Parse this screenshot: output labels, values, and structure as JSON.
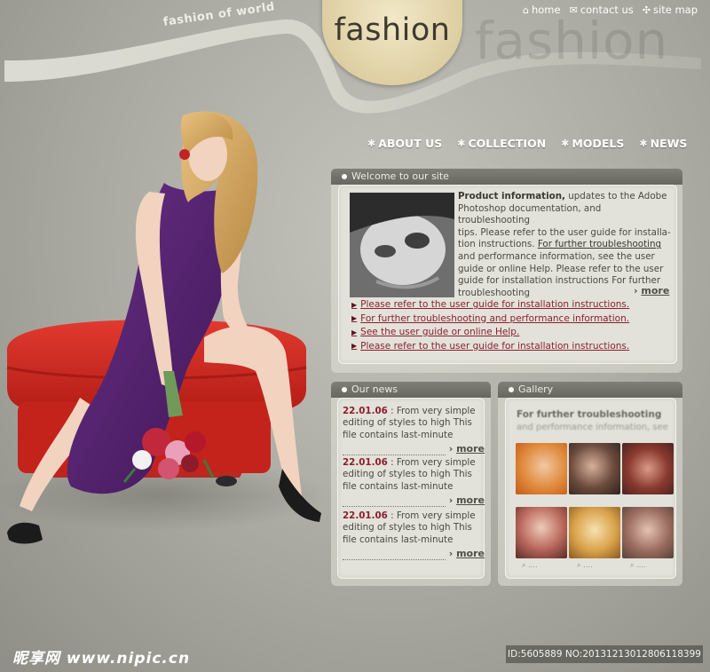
{
  "top_links": [
    {
      "icon": "home-icon",
      "label": "home"
    },
    {
      "icon": "mail-icon",
      "label": "contact us"
    },
    {
      "icon": "sitemap-icon",
      "label": "site map"
    }
  ],
  "logo": {
    "text": "fashion",
    "ghost_text": "fashion",
    "tagline": "fashion of world"
  },
  "main_nav": [
    "ABOUT US",
    "COLLECTION",
    "MODELS",
    "NEWS"
  ],
  "welcome": {
    "title": "Welcome to our site",
    "product_title": "Product information,",
    "line1": " updates to the Adobe",
    "line2": "Photoshop documentation, and troubleshooting",
    "line3": "tips. Please refer to the user guide for installa-",
    "line4a": "tion instructions. ",
    "line4b": "For further troubleshooting",
    "line5": "and performance information, see the user",
    "line6": "guide or online Help.  Please refer to the user",
    "line7": "guide for installation instructions For further",
    "line8": "troubleshooting",
    "more": "more",
    "links": [
      "Please refer to the user guide for installation instructions.",
      "For further troubleshooting and performance information.",
      "See the user guide or online Help.",
      "Please refer to the user guide for installation instructions."
    ]
  },
  "news": {
    "title": "Our news",
    "items": [
      {
        "date": "22.01.06",
        "l1": " : From very simple",
        "l2": "editing of styles to high This",
        "l3": "file contains last-minute",
        "more": "more"
      },
      {
        "date": "22.01.06",
        "l1": " : From very simple",
        "l2": "editing of styles to high This",
        "l3": "file contains last-minute",
        "more": "more"
      },
      {
        "date": "22.01.06",
        "l1": " : From very simple",
        "l2": "editing of styles to high This",
        "l3": "file contains last-minute",
        "more": "more"
      }
    ]
  },
  "gallery": {
    "title": "Gallery",
    "heading": "For further troubleshooting",
    "subheading": "and performance information, see"
  },
  "watermark": {
    "left": "昵享网 www.nipic.cn",
    "right": "ID:5605889 NO:20131213012806118399"
  }
}
